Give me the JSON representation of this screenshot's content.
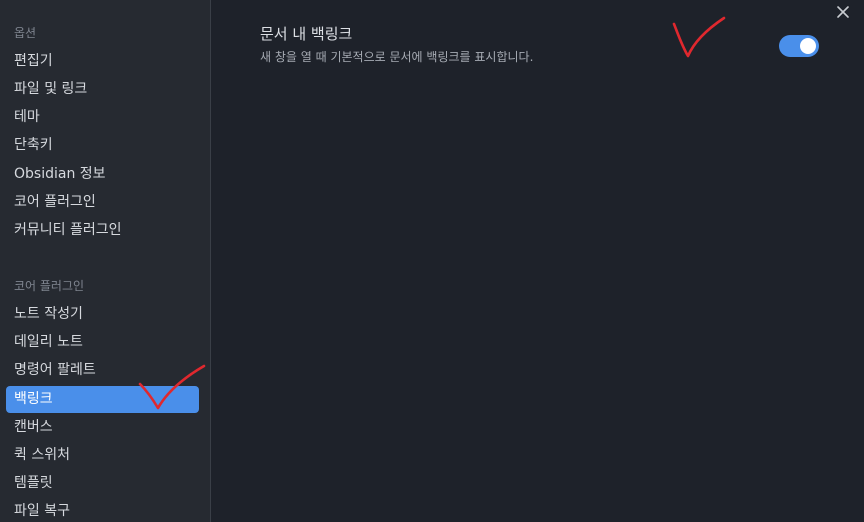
{
  "sidebar": {
    "options_header": "옵션",
    "options_items": [
      {
        "label": "편집기"
      },
      {
        "label": "파일 및 링크"
      },
      {
        "label": "테마"
      },
      {
        "label": "단축키"
      },
      {
        "label": "Obsidian 정보"
      },
      {
        "label": "코어 플러그인"
      },
      {
        "label": "커뮤니티 플러그인"
      }
    ],
    "core_header": "코어 플러그인",
    "core_items": [
      {
        "label": "노트 작성기"
      },
      {
        "label": "데일리 노트"
      },
      {
        "label": "명령어 팔레트"
      },
      {
        "label": "백링크",
        "active": true
      },
      {
        "label": "캔버스"
      },
      {
        "label": "퀵 스위처"
      },
      {
        "label": "템플릿"
      },
      {
        "label": "파일 복구"
      }
    ]
  },
  "main": {
    "setting": {
      "title": "문서 내 백링크",
      "description": "새 창을 열 때 기본적으로 문서에 백링크를 표시합니다.",
      "enabled": true
    }
  },
  "icons": {
    "close": "close-icon"
  },
  "colors": {
    "accent": "#4a8fea",
    "annotation": "#e0282e",
    "background": "#1e222a",
    "sidebar": "#262a31"
  }
}
